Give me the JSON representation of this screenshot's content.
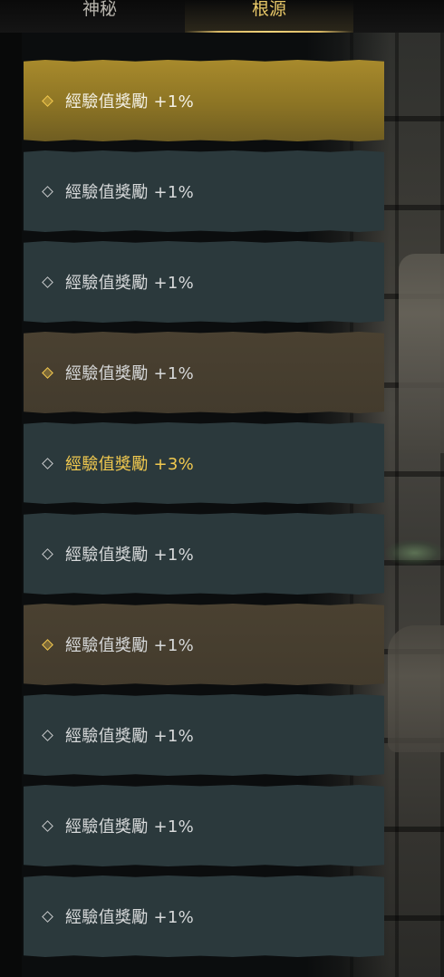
{
  "tabs": {
    "mystic": "神秘",
    "origin": "根源",
    "active": "origin"
  },
  "rewards": [
    {
      "label": "經驗值獎勵 +1%",
      "state": "selected"
    },
    {
      "label": "經驗值獎勵 +1%",
      "state": "locked"
    },
    {
      "label": "經驗值獎勵 +1%",
      "state": "locked"
    },
    {
      "label": "經驗值獎勵 +1%",
      "state": "milestone"
    },
    {
      "label": "經驗值獎勵 +3%",
      "state": "locked",
      "highlight": true
    },
    {
      "label": "經驗值獎勵 +1%",
      "state": "locked"
    },
    {
      "label": "經驗值獎勵 +1%",
      "state": "milestone"
    },
    {
      "label": "經驗值獎勵 +1%",
      "state": "locked"
    },
    {
      "label": "經驗值獎勵 +1%",
      "state": "locked"
    },
    {
      "label": "經驗值獎勵 +1%",
      "state": "locked"
    }
  ],
  "colors": {
    "selected_gold": "#a88a2c",
    "milestone_brown": "#4a4131",
    "locked_slate": "#2b393c",
    "highlight_text": "#f1c94f",
    "tab_active_text": "#e8c868"
  },
  "icons": {
    "row_marker": "diamond-icon"
  }
}
